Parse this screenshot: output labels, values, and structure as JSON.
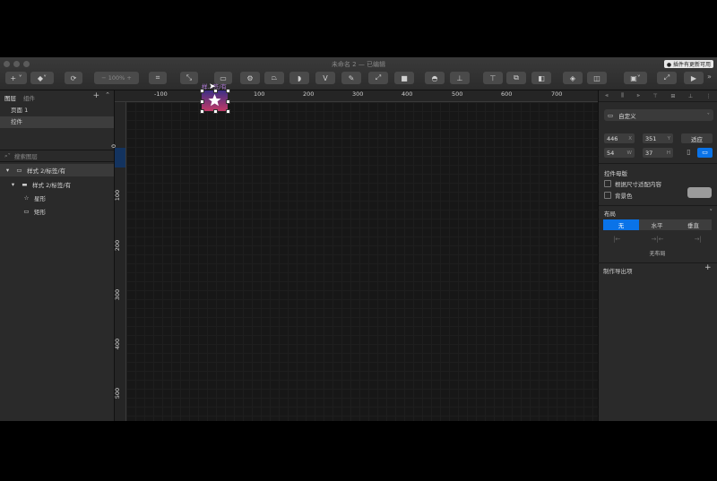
{
  "window": {
    "title": "未命名 2 — 已编辑",
    "update_badge": "● 插件有更新可用"
  },
  "toolbar": {
    "zoom": "100%",
    "zoom_minus": "−",
    "zoom_plus": "+"
  },
  "sidebar": {
    "tabs": [
      "图层",
      "组件"
    ],
    "pages": [
      "页面 1",
      "控件"
    ],
    "search_placeholder": "搜索图层",
    "layers": [
      "样式 2/标签/有",
      "样式 2/标签/有",
      "星形",
      "矩形"
    ]
  },
  "ruler": {
    "top": [
      "-100",
      "0",
      "100",
      "200",
      "300",
      "400",
      "500",
      "600",
      "700"
    ],
    "left": [
      "0",
      "100",
      "200",
      "300",
      "400",
      "500"
    ]
  },
  "canvas": {
    "artboard_name": "样...签/有"
  },
  "inspector": {
    "preset": "自定义",
    "x": "446",
    "x_label": "X",
    "y": "351",
    "y_label": "Y",
    "fit_button": "适应",
    "w": "54",
    "w_label": "W",
    "h": "37",
    "h_label": "H",
    "symbol_section": "控件母版",
    "resize_checkbox": "根据尺寸适配内容",
    "background_checkbox": "背景色",
    "layout_section": "布局",
    "layout_options": [
      "无",
      "水平",
      "垂直"
    ],
    "no_layout_text": "无布局",
    "export_section": "制作导出项"
  },
  "colors": {
    "accent": "#0a73e8",
    "artboard_top": "#3c2f86",
    "artboard_bottom": "#c23a67",
    "artboard_label": "#b07bd6"
  }
}
